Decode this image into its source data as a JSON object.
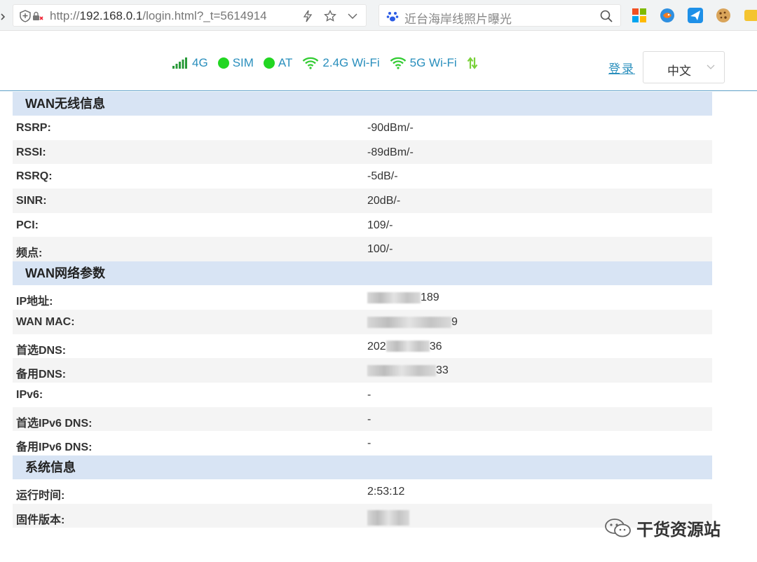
{
  "browser": {
    "url_prefix": "http://",
    "url_host": "192.168.0.1",
    "url_path": "/login.html?_t=5614914",
    "search_text": "近台海岸线照片曝光"
  },
  "status": {
    "signal_label": "4G",
    "sim_label": "SIM",
    "at_label": "AT",
    "wifi24_label": "2.4G Wi-Fi",
    "wifi5_label": "5G Wi-Fi",
    "login_label": "登录",
    "language_selected": "中文"
  },
  "colors": {
    "accent": "#2a8fbd",
    "status_green": "#22d622",
    "section_bg": "#d8e4f4",
    "alt_row_bg": "#f4f4f4"
  },
  "sections": {
    "wan_wireless": {
      "title": "WAN无线信息",
      "rows": [
        {
          "label": "RSRP:",
          "value": "-90dBm/-"
        },
        {
          "label": "RSSI:",
          "value": "-89dBm/-"
        },
        {
          "label": "RSRQ:",
          "value": "-5dB/-"
        },
        {
          "label": "SINR:",
          "value": "20dB/-"
        },
        {
          "label": "PCI:",
          "value": "109/-"
        },
        {
          "label": "频点:",
          "value": "100/-"
        }
      ]
    },
    "wan_network": {
      "title": "WAN网络参数",
      "rows": [
        {
          "label": "IP地址:",
          "value": "189"
        },
        {
          "label": "WAN MAC:",
          "value": "9"
        },
        {
          "label": "首选DNS:",
          "value_prefix": "202",
          "value_suffix": "36"
        },
        {
          "label": "备用DNS:",
          "value": "33"
        },
        {
          "label": "IPv6:",
          "value": "-"
        },
        {
          "label": "首选IPv6 DNS:",
          "value": "-"
        },
        {
          "label": "备用IPv6 DNS:",
          "value": "-"
        }
      ]
    },
    "system": {
      "title": "系统信息",
      "rows": [
        {
          "label": "运行时间:",
          "value": "2:53:12"
        },
        {
          "label": "固件版本:",
          "value": ""
        }
      ]
    }
  },
  "watermark": {
    "text": "干货资源站"
  }
}
